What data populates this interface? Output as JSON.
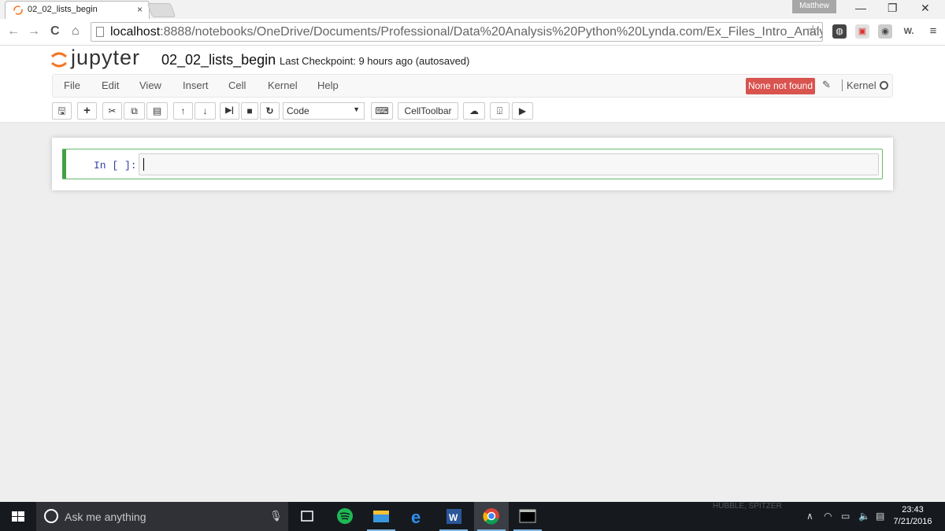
{
  "browser": {
    "tab_title": "02_02_lists_begin",
    "tab_close": "×",
    "user": "Matthew",
    "url_host": "localhost",
    "url_rest": ":8888/notebooks/OneDrive/Documents/Professional/Data%20Analysis%20Python%20Lynda.com/Ex_Files_Intro_Analysis_Pyth",
    "ext_w": "W."
  },
  "jupyter": {
    "logo_text": "jupyter",
    "notebook_name": "02_02_lists_begin",
    "checkpoint": "Last Checkpoint: 9 hours ago (autosaved)",
    "menu": [
      "File",
      "Edit",
      "View",
      "Insert",
      "Cell",
      "Kernel",
      "Help"
    ],
    "kernel_status": "None not found",
    "kernel_label": "Kernel",
    "cell_type": "Code",
    "celltoolbar_label": "CellToolbar",
    "colors": {
      "accent": "#f37726",
      "error": "#d9534f",
      "cell_border": "#43a047",
      "prompt": "#303f9f"
    }
  },
  "notebook": {
    "cells": [
      {
        "prompt": "In [ ]:",
        "source": ""
      }
    ]
  },
  "taskbar": {
    "search_placeholder": "Ask me anything",
    "wallpaper_caption": "HUBBLE, SPITZER",
    "time": "23:43",
    "date": "7/21/2016"
  }
}
